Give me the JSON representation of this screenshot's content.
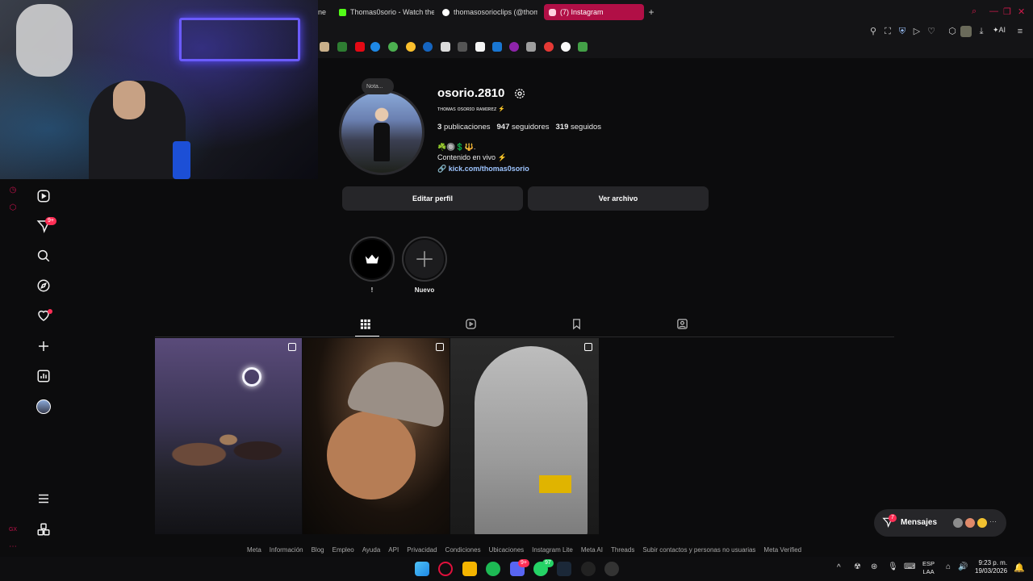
{
  "browser": {
    "tabs": [
      {
        "label": "ne",
        "icon": "tab-icon",
        "color": "#444444"
      },
      {
        "label": "Thomas0sorio - Watch the",
        "icon": "kick-icon",
        "color": "#53fc18"
      },
      {
        "label": "thomasosorioclips (@thom",
        "icon": "tiktok-icon",
        "color": "#ffffff"
      },
      {
        "label": "(7) Instagram",
        "icon": "instagram-icon",
        "color": "#e1306c",
        "active": true
      }
    ],
    "new_tab_label": "+",
    "ai_label": "AI"
  },
  "profile": {
    "note_label": "Nota...",
    "username": "osorio.2810",
    "full_name": "ᴛʜᴏᴍᴀs ᴏsᴏʀɪᴏ ʀᴀᴍɪʀᴇᴢ ⚡",
    "posts_count": "3",
    "posts_label": "publicaciones",
    "followers_count": "947",
    "followers_label": "seguidores",
    "following_count": "319",
    "following_label": "seguidos",
    "emoji_line": "☘️🔘💲🔱.",
    "bio": "Contenido en vivo ⚡",
    "link": "kick.com/thomas0sorio",
    "edit_button": "Editar perfil",
    "archive_button": "Ver archivo"
  },
  "highlights": [
    {
      "label": "!",
      "icon": "crown-icon"
    },
    {
      "label": "Nuevo",
      "icon": "plus-icon"
    }
  ],
  "nav_badges": {
    "notifications": "9+"
  },
  "messages": {
    "label": "Mensajes",
    "badge": "7"
  },
  "footer_links": [
    "Meta",
    "Información",
    "Blog",
    "Empleo",
    "Ayuda",
    "API",
    "Privacidad",
    "Condiciones",
    "Ubicaciones",
    "Instagram Lite",
    "Meta AI",
    "Threads",
    "Subir contactos y personas no usuarias",
    "Meta Verified"
  ],
  "taskbar": {
    "lang_line1": "ESP",
    "lang_line2": "LAA",
    "time": "9:23 p. m.",
    "date": "19/03/2026",
    "discord_badge": "9+",
    "whatsapp_badge": "97"
  },
  "colors": {
    "accent": "#b10f46",
    "link": "#9ec5ff",
    "badge": "#ff2e55"
  }
}
